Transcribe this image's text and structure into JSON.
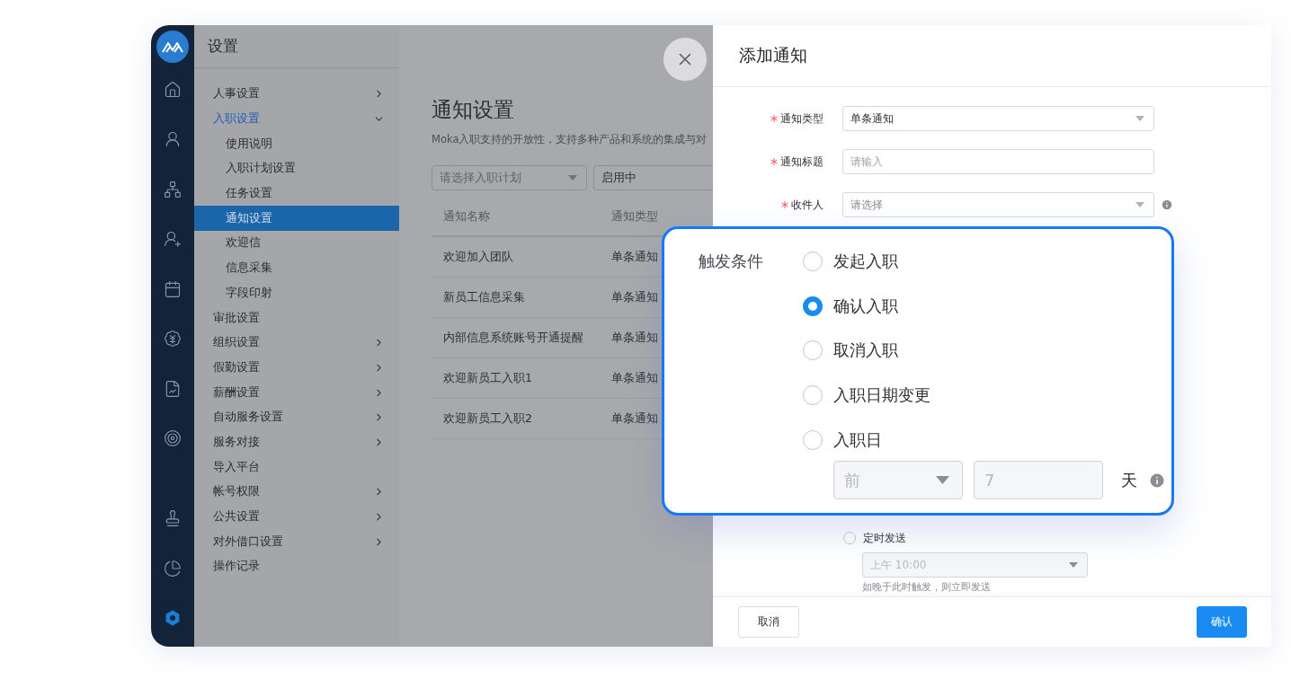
{
  "rail": {
    "items": [
      {
        "kind": "home",
        "selected": false
      },
      {
        "kind": "people",
        "selected": false
      },
      {
        "kind": "org",
        "selected": false
      },
      {
        "kind": "onboard",
        "selected": false
      },
      {
        "kind": "calendar",
        "selected": false
      },
      {
        "kind": "salary",
        "selected": false
      },
      {
        "kind": "report",
        "selected": false
      },
      {
        "kind": "target",
        "selected": false
      },
      {
        "kind": "stamp",
        "selected": false
      },
      {
        "kind": "pie",
        "selected": false
      },
      {
        "kind": "settings",
        "selected": true
      }
    ]
  },
  "sidebar": {
    "title": "设置",
    "items": [
      {
        "label": "人事设置",
        "expandable": true,
        "expanded": false,
        "selected": false
      },
      {
        "label": "入职设置",
        "expandable": true,
        "expanded": true,
        "selected": false,
        "children": [
          {
            "label": "使用说明",
            "selected": false
          },
          {
            "label": "入职计划设置",
            "selected": false
          },
          {
            "label": "任务设置",
            "selected": false
          },
          {
            "label": "通知设置",
            "selected": true
          },
          {
            "label": "欢迎信",
            "selected": false
          },
          {
            "label": "信息采集",
            "selected": false
          },
          {
            "label": "字段印射",
            "selected": false
          }
        ]
      },
      {
        "label": "审批设置",
        "expandable": false,
        "expanded": false,
        "selected": false
      },
      {
        "label": "组织设置",
        "expandable": true,
        "expanded": false,
        "selected": false
      },
      {
        "label": "假勤设置",
        "expandable": true,
        "expanded": false,
        "selected": false
      },
      {
        "label": "薪酬设置",
        "expandable": true,
        "expanded": false,
        "selected": false
      },
      {
        "label": "自动服务设置",
        "expandable": true,
        "expanded": false,
        "selected": false
      },
      {
        "label": "服务对接",
        "expandable": true,
        "expanded": false,
        "selected": false
      },
      {
        "label": "导入平台",
        "expandable": false,
        "expanded": false,
        "selected": false
      },
      {
        "label": "帐号权限",
        "expandable": true,
        "expanded": false,
        "selected": false
      },
      {
        "label": "公共设置",
        "expandable": true,
        "expanded": false,
        "selected": false
      },
      {
        "label": "对外借口设置",
        "expandable": true,
        "expanded": false,
        "selected": false
      },
      {
        "label": "操作记录",
        "expandable": false,
        "expanded": false,
        "selected": false
      }
    ]
  },
  "main": {
    "title": "通知设置",
    "description": "Moka入职支持的开放性，支持多种产品和系统的集成与对",
    "filters": [
      {
        "kind": "dropdown",
        "placeholder": "请选择入职计划"
      },
      {
        "kind": "field",
        "value": "启用中"
      }
    ],
    "table": {
      "columns": [
        "通知名称",
        "通知类型"
      ],
      "rows": [
        [
          "欢迎加入团队",
          "单条通知"
        ],
        [
          "新员工信息采集",
          "单条通知"
        ],
        [
          "内部信息系统账号开通提醒",
          "单条通知"
        ],
        [
          "欢迎新员工入职1",
          "单条通知"
        ],
        [
          "欢迎新员工入职2",
          "单条通知"
        ]
      ]
    }
  },
  "drawer": {
    "title": "添加通知",
    "fields": [
      {
        "label": "通知类型",
        "required": true,
        "kind": "dropdown",
        "value": "单条通知",
        "info": false
      },
      {
        "label": "通知标题",
        "required": true,
        "kind": "text",
        "placeholder": "请输入",
        "info": false
      },
      {
        "label": "收件人",
        "required": true,
        "kind": "dropdown",
        "placeholder": "请选择",
        "info": true
      }
    ],
    "send_options": [
      {
        "label": "定时发送",
        "selected": false
      }
    ],
    "time_select": {
      "value": "上午 10:00",
      "disabled": true
    },
    "hint": "如晚于此时触发，则立即发送",
    "buttons": [
      {
        "label": "取消",
        "kind": "secondary"
      },
      {
        "label": "确认",
        "kind": "primary"
      }
    ]
  },
  "trigger_card": {
    "label": "触发条件",
    "options": [
      {
        "label": "发起入职",
        "selected": false
      },
      {
        "label": "确认入职",
        "selected": true
      },
      {
        "label": "取消入职",
        "selected": false
      },
      {
        "label": "入职日期变更",
        "selected": false
      },
      {
        "label": "入职日",
        "selected": false
      }
    ],
    "offset": {
      "direction": "前",
      "days": "7",
      "unit": "天",
      "disabled": true
    }
  }
}
